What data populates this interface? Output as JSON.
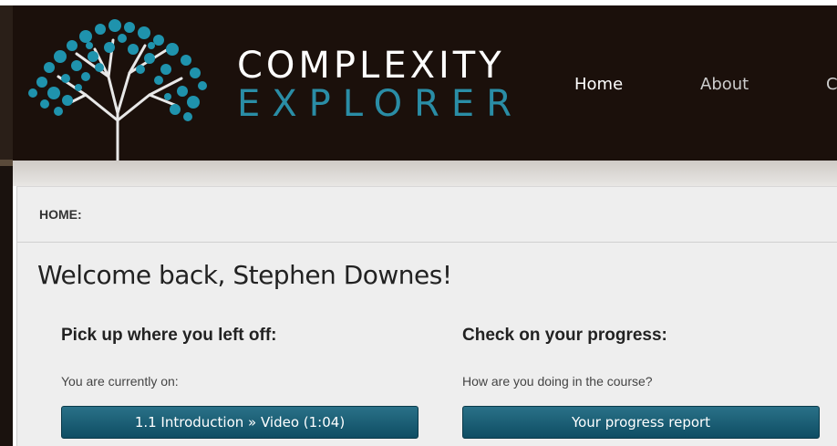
{
  "header": {
    "logo_line1": "COMPLEXITY",
    "logo_line2": "EXPLORER",
    "nav": [
      {
        "label": "Home"
      },
      {
        "label": "About"
      },
      {
        "label": "C"
      }
    ]
  },
  "breadcrumb": "HOME:",
  "welcome": "Welcome back, Stephen Downes!",
  "left_col": {
    "heading": "Pick up where you left off:",
    "text": "You are currently on:",
    "button": "1.1 Introduction » Video (1:04)"
  },
  "right_col": {
    "heading": "Check on your progress:",
    "text": "How are you doing in the course?",
    "button": "Your progress report"
  },
  "colors": {
    "header_bg": "#1b100b",
    "brand_teal": "#2a8da6",
    "button": "#0e4d63",
    "panel_bg": "#eeeeee"
  }
}
